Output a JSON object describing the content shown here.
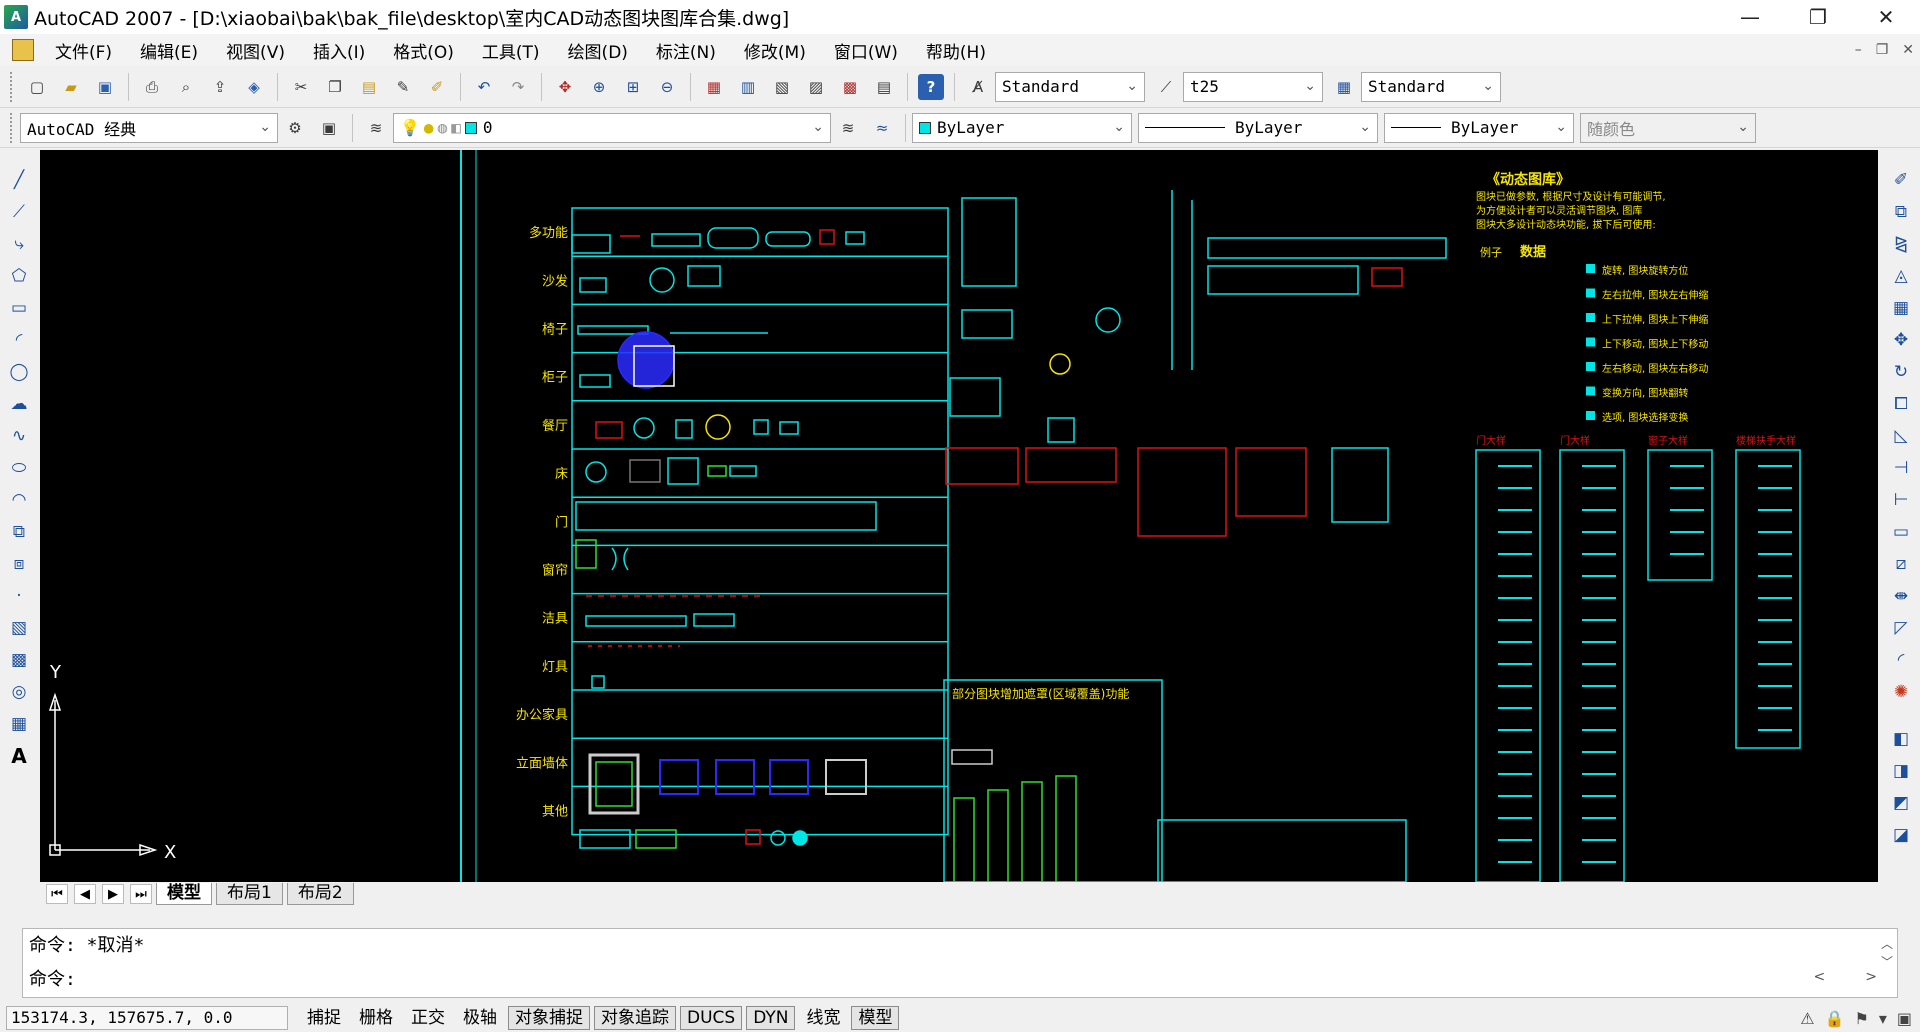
{
  "window": {
    "title": "AutoCAD 2007 - [D:\\xiaobai\\bak\\bak_file\\desktop\\室内CAD动态图块图库合集.dwg]",
    "app_icon": "autocad-logo-icon",
    "minimize": "—",
    "restore": "❐",
    "close": "✕"
  },
  "menu": {
    "items": [
      "文件(F)",
      "编辑(E)",
      "视图(V)",
      "插入(I)",
      "格式(O)",
      "工具(T)",
      "绘图(D)",
      "标注(N)",
      "修改(M)",
      "窗口(W)",
      "帮助(H)"
    ],
    "mdi_min": "–",
    "mdi_restore": "❐",
    "mdi_close": "✕"
  },
  "toolbar": {
    "text_style": "Standard",
    "dim_style": "t25",
    "table_style": "Standard",
    "workspace": "AutoCAD 经典",
    "layer": "0",
    "color": "ByLayer",
    "linetype": "ByLayer",
    "lineweight": "ByLayer",
    "plot_style": "随颜色"
  },
  "drawing": {
    "categories": [
      "多功能",
      "沙发",
      "椅子",
      "柜子",
      "餐厅",
      "床",
      "门",
      "窗帘",
      "洁具",
      "灯具",
      "办公家具",
      "立面墙体",
      "其他"
    ],
    "annotation": "部分图块增加遮罩(区域覆盖)功能",
    "legend_title": "《动态图库》",
    "legend_intro": [
      "图块已做参数, 根据尺寸及设计有可能调节,",
      "为方便设计者可以灵活调节图块, 图库",
      "图块大多设计动态块功能, 拔下后可使用:"
    ],
    "legend_labels": [
      "例子",
      "数据"
    ],
    "legend_rows": [
      "旋转, 图块旋转方位",
      "左右拉伸, 图块左右伸缩",
      "上下拉伸, 图块上下伸缩",
      "上下移动, 图块上下移动",
      "左右移动, 图块左右移动",
      "变换方向, 图块翻转",
      "选项, 图块选择变换"
    ],
    "column_labels": [
      "门大样",
      "门大样",
      "窗子大样",
      "楼梯扶手大样"
    ],
    "axis_x": "X",
    "axis_y": "Y"
  },
  "tabs": {
    "items": [
      "模型",
      "布局1",
      "布局2"
    ],
    "active": "模型"
  },
  "command": {
    "history": "命令: *取消*",
    "prompt": "命令:"
  },
  "status": {
    "coords": "153174.3, 157675.7, 0.0",
    "buttons": [
      "捕捉",
      "栅格",
      "正交",
      "极轴",
      "对象捕捉",
      "对象追踪",
      "DUCS",
      "DYN",
      "线宽",
      "模型"
    ],
    "on_buttons": [
      "对象捕捉",
      "对象追踪",
      "DUCS",
      "DYN",
      "模型"
    ]
  },
  "colors": {
    "canvas_bg": "#000000",
    "cyan": "#00e5e5",
    "green": "#2ee02e",
    "red": "#e01010",
    "yellow": "#f5e400",
    "blue": "#2a2aff",
    "white": "#ffffff"
  }
}
